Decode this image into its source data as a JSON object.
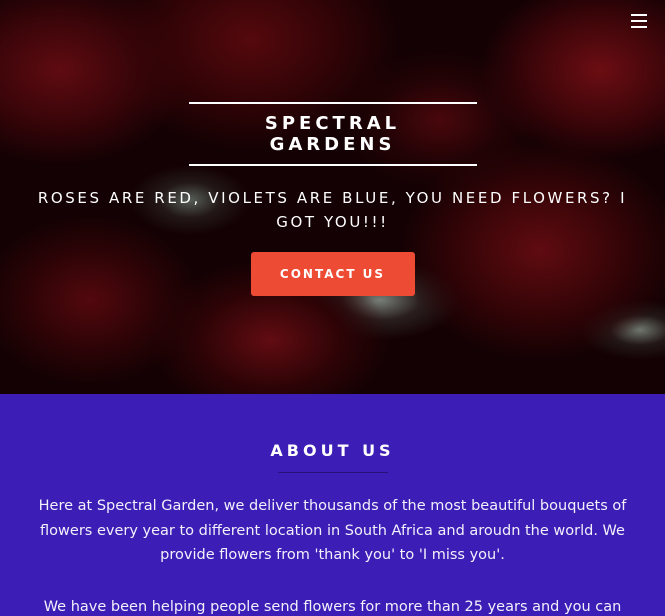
{
  "hero": {
    "brand_title": "SPECTRAL GARDENS",
    "tagline": "ROSES ARE RED, VIOLETS ARE BLUE, YOU NEED FLOWERS? I GOT YOU!!!",
    "contact_button": "CONTACT US",
    "accent_color": "#ee4b35",
    "menu_icon": "hamburger-menu-icon"
  },
  "about": {
    "heading": "ABOUT US",
    "paragraph_1": "Here at Spectral Garden, we deliver thousands of the most beautiful bouquets of flowers every year to different location in South Africa and aroudn the world. We provide flowers from 'thank you' to 'I miss you'.",
    "paragraph_2": "We have been helping people send flowers for more than 25 years and you can",
    "background_color": "#3c1db6"
  }
}
